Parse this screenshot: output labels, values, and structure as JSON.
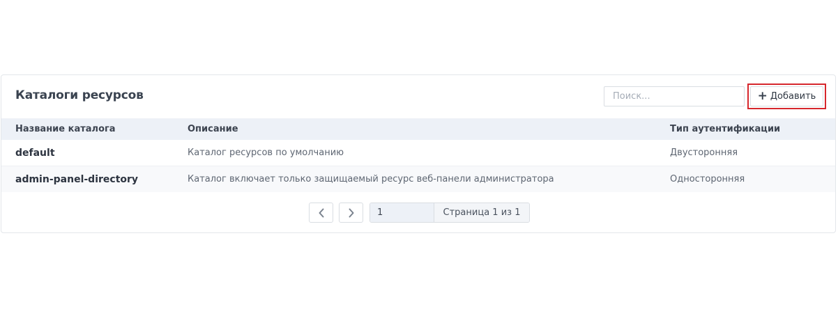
{
  "panel": {
    "title": "Каталоги ресурсов"
  },
  "search": {
    "placeholder": "Поиск..."
  },
  "toolbar": {
    "add_label": "Добавить"
  },
  "table": {
    "columns": [
      "Название каталога",
      "Описание",
      "Тип аутентификации"
    ],
    "rows": [
      {
        "name": "default",
        "description": "Каталог ресурсов по умолчанию",
        "auth_type": "Двусторонняя"
      },
      {
        "name": "admin-panel-directory",
        "description": "Каталог включает только защищаемый ресурс веб-панели администратора",
        "auth_type": "Односторонняя"
      }
    ]
  },
  "pagination": {
    "page_value": "1",
    "page_label": "Страница 1 из 1",
    "prev_icon": "chevron-left-icon",
    "next_icon": "chevron-right-icon"
  },
  "colors": {
    "highlight": "#d6262c",
    "header_bg": "#edf1f7"
  }
}
